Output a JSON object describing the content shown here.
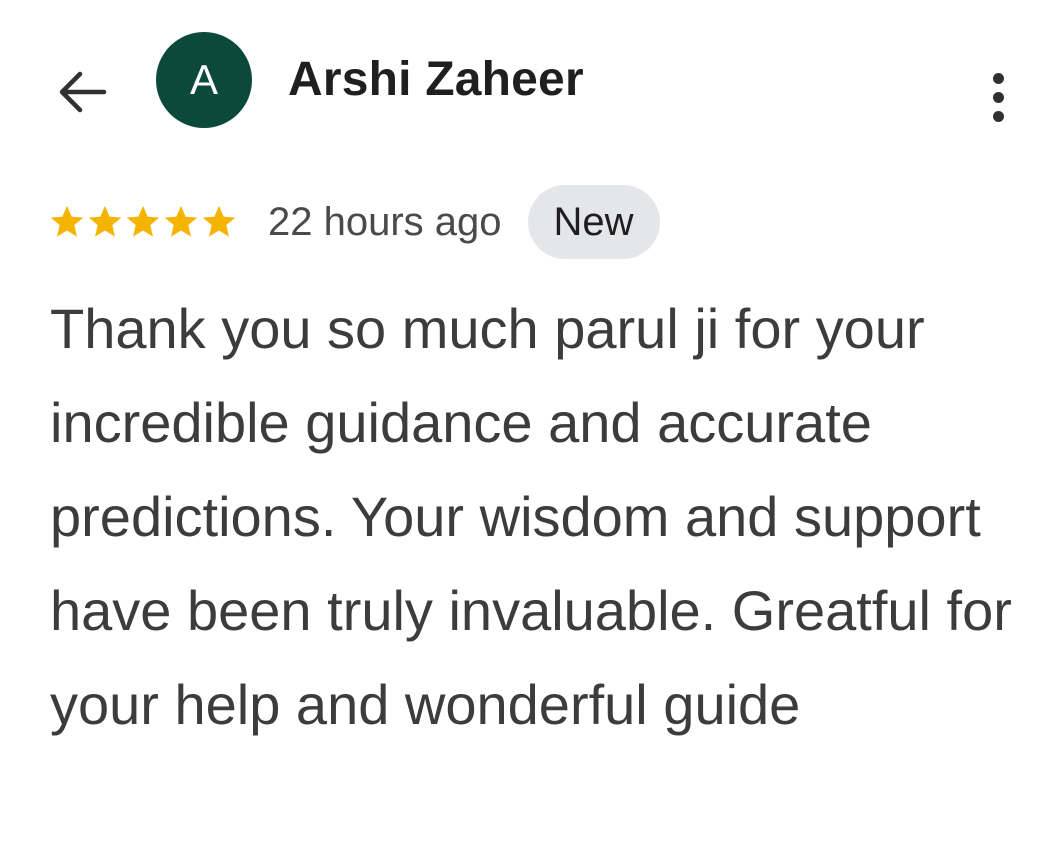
{
  "review": {
    "author_name": "Arshi Zaheer",
    "avatar_initial": "A",
    "rating": 5,
    "rating_max": 5,
    "timestamp": "22 hours ago",
    "badge": "New",
    "text": "Thank you so much parul ji for your incredible guidance and accurate predictions. Your wisdom and support have been truly invaluable. Greatful for your help and wonderful guide"
  },
  "colors": {
    "avatar_bg": "#0b4a3a",
    "star": "#f5b400",
    "badge_bg": "#e4e6ea"
  },
  "icons": {
    "back": "arrow-left-icon",
    "more": "more-vert-icon",
    "star": "star-icon"
  }
}
